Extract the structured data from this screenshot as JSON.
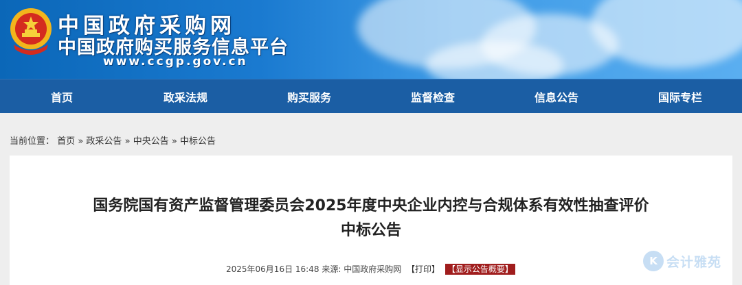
{
  "header": {
    "site_title": "中国政府采购网",
    "site_subtitle": "中国政府购买服务信息平台",
    "site_url": "www.ccgp.gov.cn"
  },
  "nav": {
    "items": [
      {
        "label": "首页"
      },
      {
        "label": "政采法规"
      },
      {
        "label": "购买服务"
      },
      {
        "label": "监督检查"
      },
      {
        "label": "信息公告"
      },
      {
        "label": "国际专栏"
      }
    ]
  },
  "breadcrumb": {
    "prefix": "当前位置：",
    "items": [
      "首页",
      "政采公告",
      "中央公告",
      "中标公告"
    ],
    "separator": "»"
  },
  "article": {
    "title_line1": "国务院国有资产监督管理委员会2025年度中央企业内控与合规体系有效性抽查评价",
    "title_line2": "中标公告",
    "datetime": "2025年06月16日 16:48",
    "source_label": "来源:",
    "source": "中国政府采购网",
    "print_label": "【打印】",
    "summary_label": "【显示公告概要】"
  },
  "watermark": {
    "text": "会计雅苑"
  },
  "colors": {
    "nav_bg": "#1b5ea4",
    "summary_bg": "#a01d1d"
  }
}
